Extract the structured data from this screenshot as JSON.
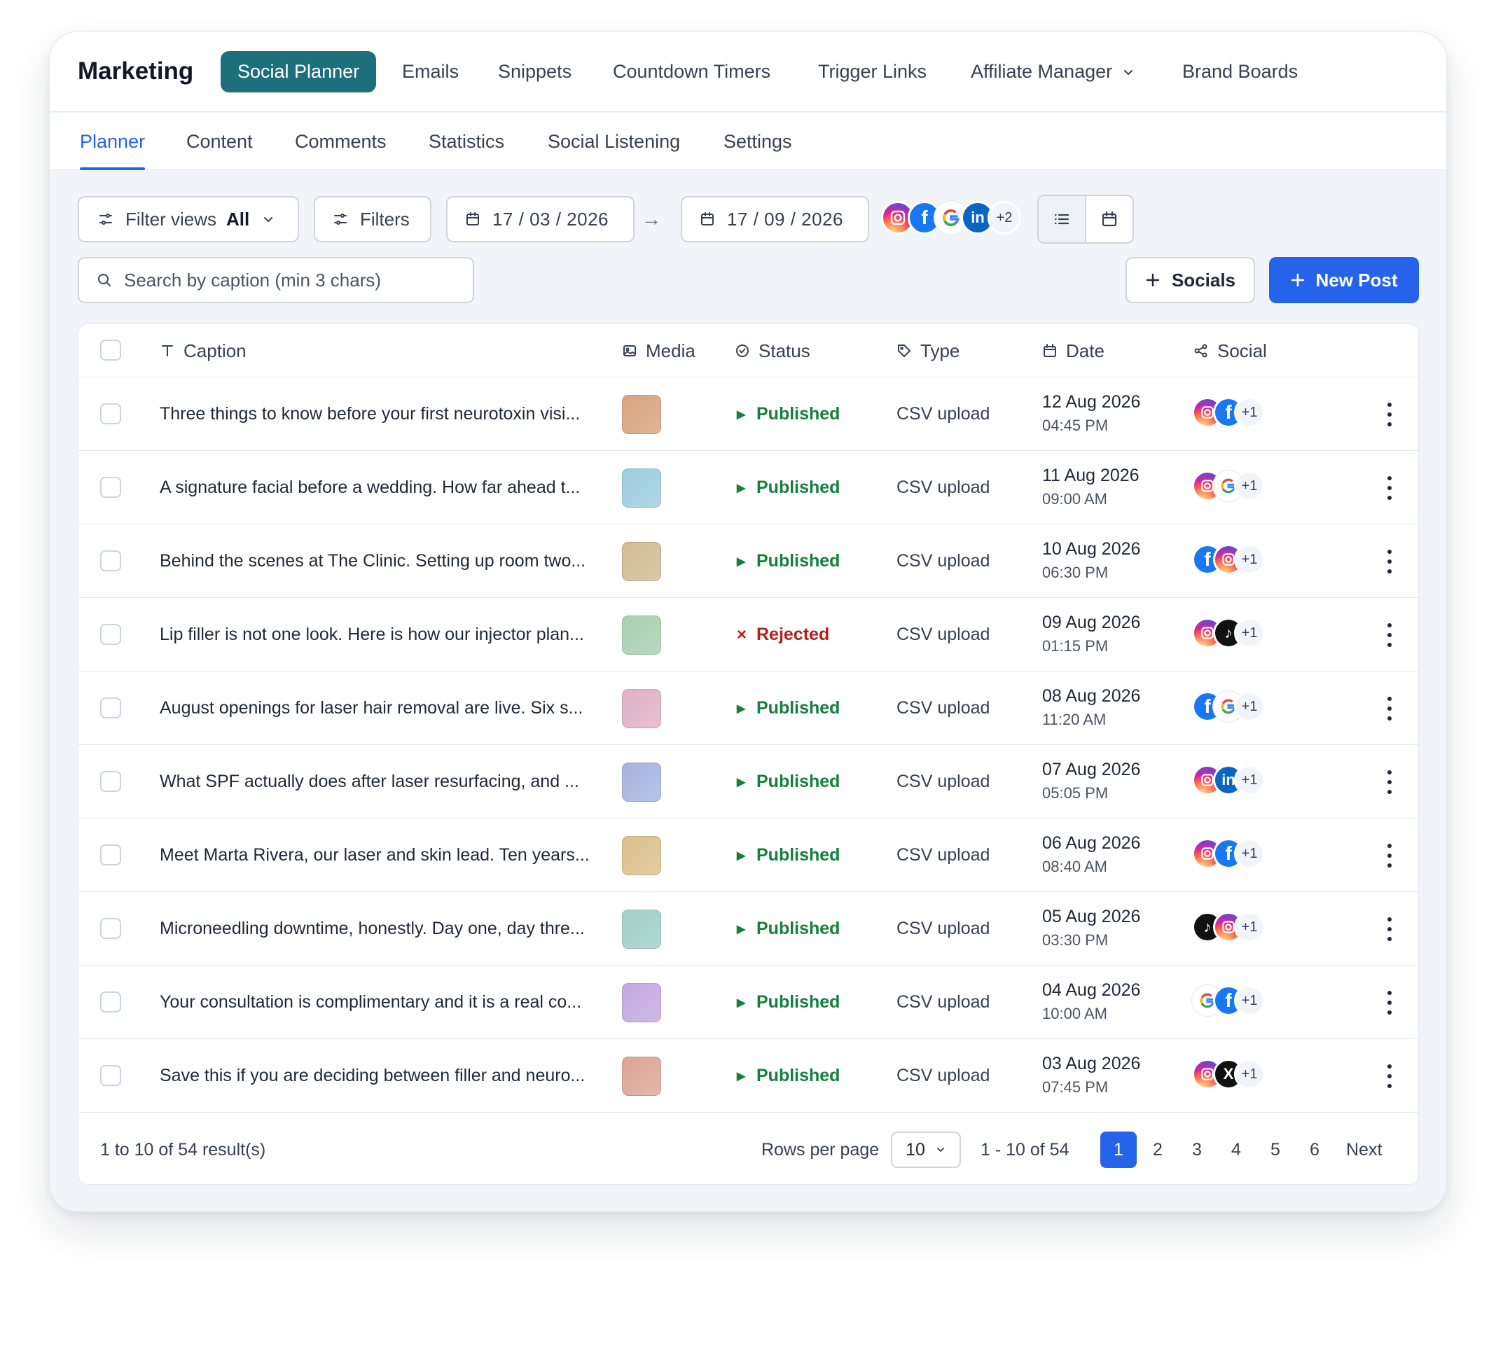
{
  "app": {
    "title": "Marketing"
  },
  "topnav": [
    {
      "label": "Social Planner",
      "active": true
    },
    {
      "label": "Emails"
    },
    {
      "label": "Snippets"
    },
    {
      "label": "Countdown Timers"
    },
    {
      "label": "Trigger Links"
    },
    {
      "label": "Affiliate Manager",
      "icon": "chevron-down-icon"
    },
    {
      "label": "Brand Boards"
    }
  ],
  "subnav": [
    {
      "label": "Planner",
      "active": true
    },
    {
      "label": "Content"
    },
    {
      "label": "Comments"
    },
    {
      "label": "Statistics"
    },
    {
      "label": "Social Listening"
    },
    {
      "label": "Settings"
    }
  ],
  "toolbar": {
    "filter_views_label": "Filter views",
    "filter_views_value": "All",
    "filters_label": "Filters",
    "start_date": "17 / 03 / 2026",
    "end_date": "17 / 09 / 2026",
    "range_arrow": "→",
    "accounts": [
      "instagram",
      "facebook",
      "google",
      "linkedin"
    ],
    "accounts_more": "+2",
    "view_mode": "list",
    "search_placeholder": "Search by caption (min 3 chars)",
    "socials_label": "Socials",
    "new_post_label": "New Post"
  },
  "table": {
    "columns": {
      "caption": "Caption",
      "media": "Media",
      "status": "Status",
      "type": "Type",
      "date": "Date",
      "social": "Social"
    },
    "rows": [
      {
        "caption": "Three things to know before your first neurotoxin visi...",
        "media_color": "#d9a37e",
        "status": "Published",
        "type": "CSV upload",
        "date": "12 Aug 2026",
        "time": "04:45 PM",
        "socials": [
          "instagram",
          "facebook"
        ],
        "more": "+1"
      },
      {
        "caption": "A signature facial before a wedding. How far ahead t...",
        "media_color": "#9ecde0",
        "status": "Published",
        "type": "CSV upload",
        "date": "11 Aug 2026",
        "time": "09:00 AM",
        "socials": [
          "instagram",
          "google"
        ],
        "more": "+1"
      },
      {
        "caption": "Behind the scenes at The Clinic. Setting up room two...",
        "media_color": "#d1bb92",
        "status": "Published",
        "type": "CSV upload",
        "date": "10 Aug 2026",
        "time": "06:30 PM",
        "socials": [
          "facebook",
          "instagram"
        ],
        "more": "+1"
      },
      {
        "caption": "Lip filler is not one look. Here is how our injector plan...",
        "media_color": "#a9cfb0",
        "status": "Rejected",
        "type": "CSV upload",
        "date": "09 Aug 2026",
        "time": "01:15 PM",
        "socials": [
          "instagram",
          "tiktok"
        ],
        "more": "+1"
      },
      {
        "caption": "August openings for laser hair removal are live. Six s...",
        "media_color": "#e0b1c6",
        "status": "Published",
        "type": "CSV upload",
        "date": "08 Aug 2026",
        "time": "11:20 AM",
        "socials": [
          "facebook",
          "google"
        ],
        "more": "+1"
      },
      {
        "caption": "What SPF actually does after laser resurfacing, and ...",
        "media_color": "#a8b3e0",
        "status": "Published",
        "type": "CSV upload",
        "date": "07 Aug 2026",
        "time": "05:05 PM",
        "socials": [
          "instagram",
          "linkedin"
        ],
        "more": "+1"
      },
      {
        "caption": "Meet Marta Rivera, our laser and skin lead. Ten years...",
        "media_color": "#dcc08c",
        "status": "Published",
        "type": "CSV upload",
        "date": "06 Aug 2026",
        "time": "08:40 AM",
        "socials": [
          "instagram",
          "facebook"
        ],
        "more": "+1"
      },
      {
        "caption": "Microneedling downtime, honestly. Day one, day thre...",
        "media_color": "#9fd0c6",
        "status": "Published",
        "type": "CSV upload",
        "date": "05 Aug 2026",
        "time": "03:30 PM",
        "socials": [
          "tiktok",
          "instagram"
        ],
        "more": "+1"
      },
      {
        "caption": "Your consultation is complimentary and it is a real co...",
        "media_color": "#c4a8e0",
        "status": "Published",
        "type": "CSV upload",
        "date": "04 Aug 2026",
        "time": "10:00 AM",
        "socials": [
          "google",
          "facebook"
        ],
        "more": "+1"
      },
      {
        "caption": "Save this if you are deciding between filler and neuro...",
        "media_color": "#dca595",
        "status": "Published",
        "type": "CSV upload",
        "date": "03 Aug 2026",
        "time": "07:45 PM",
        "socials": [
          "instagram",
          "x"
        ],
        "more": "+1"
      }
    ]
  },
  "footer": {
    "results": "1 to 10 of 54 result(s)",
    "rows_per_page_label": "Rows per page",
    "rows_per_page_value": "10",
    "range": "1 - 10 of 54",
    "pages": [
      "1",
      "2",
      "3",
      "4",
      "5",
      "6"
    ],
    "current_page": "1",
    "next_label": "Next"
  },
  "colors": {
    "brand_teal": "#1d6f7c",
    "primary": "#2563eb",
    "published": "#15803d",
    "rejected": "#b91c1c"
  }
}
